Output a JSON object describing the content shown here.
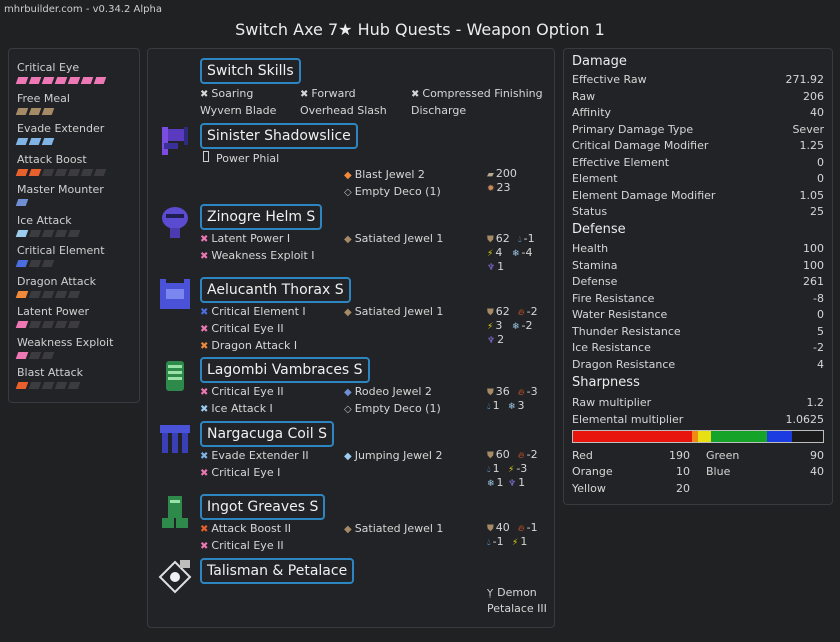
{
  "version": "mhrbuilder.com - v0.34.2 Alpha",
  "title": "Switch Axe 7★ Hub Quests - Weapon Option 1",
  "skills": [
    {
      "name": "Critical Eye",
      "color": "#ee77b5",
      "filled": 7,
      "total": 7
    },
    {
      "name": "Free Meal",
      "color": "#a58a66",
      "filled": 3,
      "total": 3
    },
    {
      "name": "Evade Extender",
      "color": "#7fb4e4",
      "filled": 3,
      "total": 3
    },
    {
      "name": "Attack Boost",
      "color": "#e8602c",
      "filled": 2,
      "total": 7
    },
    {
      "name": "Master Mounter",
      "color": "#6e8fd3",
      "filled": 1,
      "total": 1
    },
    {
      "name": "Ice Attack",
      "color": "#9dcdee",
      "filled": 1,
      "total": 5
    },
    {
      "name": "Critical Element",
      "color": "#4a6ee0",
      "filled": 1,
      "total": 3
    },
    {
      "name": "Dragon Attack",
      "color": "#f08a3a",
      "filled": 1,
      "total": 5
    },
    {
      "name": "Latent Power",
      "color": "#ee77b5",
      "filled": 1,
      "total": 5
    },
    {
      "name": "Weakness Exploit",
      "color": "#ee77b5",
      "filled": 1,
      "total": 3
    },
    {
      "name": "Blast Attack",
      "color": "#e8602c",
      "filled": 1,
      "total": 5
    }
  ],
  "gear": {
    "switch_skills": {
      "title": "Switch Skills",
      "items": [
        "Soaring",
        "Wyvern Blade",
        "Forward",
        "Overhead Slash",
        "Compressed Finishing",
        "Discharge"
      ]
    },
    "weapon": {
      "title": "Sinister Shadowslice",
      "phial": "Power Phial",
      "deco1": "Blast Jewel 2",
      "deco2": "Empty Deco (1)",
      "stat1": "200",
      "stat2": "23"
    },
    "helm": {
      "title": "Zinogre Helm S",
      "skill1": "Latent Power I",
      "skill2": "Weakness Exploit I",
      "deco1": "Satiated Jewel 1",
      "def": "62",
      "water": "-1",
      "thunder": "4",
      "ice": "-4",
      "dragon": "1"
    },
    "thorax": {
      "title": "Aelucanth Thorax S",
      "skill1": "Critical Element I",
      "skill2": "Critical Eye II",
      "skill3": "Dragon Attack I",
      "deco1": "Satiated Jewel 1",
      "def": "62",
      "fire": "-2",
      "thunder": "3",
      "ice": "-2",
      "dragon": "2"
    },
    "vambraces": {
      "title": "Lagombi Vambraces S",
      "skill1": "Critical Eye II",
      "skill2": "Ice Attack I",
      "deco1": "Rodeo Jewel 2",
      "deco2": "Empty Deco (1)",
      "def": "36",
      "fire": "-3",
      "water": "1",
      "ice": "3"
    },
    "coil": {
      "title": "Nargacuga Coil S",
      "skill1": "Evade Extender II",
      "skill2": "Critical Eye I",
      "deco1": "Jumping Jewel 2",
      "def": "60",
      "fire": "-2",
      "water": "1",
      "thunder": "-3",
      "ice": "1",
      "dragon": "1"
    },
    "greaves": {
      "title": "Ingot Greaves S",
      "skill1": "Attack Boost II",
      "skill2": "Critical Eye II",
      "deco1": "Satiated Jewel 1",
      "def": "40",
      "fire": "-1",
      "water": "-1",
      "thunder": "1"
    },
    "talisman": {
      "title": "Talisman & Petalace",
      "petalace1": "Demon",
      "petalace2": "Petalace III"
    }
  },
  "stats": {
    "damage_title": "Damage",
    "damage": [
      {
        "label": "Effective Raw",
        "value": "271.92"
      },
      {
        "label": "Raw",
        "value": "206"
      },
      {
        "label": "Affinity",
        "value": "40"
      },
      {
        "label": "Primary Damage Type",
        "value": "Sever"
      },
      {
        "label": "Critical Damage Modifier",
        "value": "1.25"
      },
      {
        "label": "Effective Element",
        "value": "0"
      },
      {
        "label": "Element",
        "value": "0"
      },
      {
        "label": "Element Damage Modifier",
        "value": "1.05"
      },
      {
        "label": "Status",
        "value": "25"
      }
    ],
    "defense_title": "Defense",
    "defense": [
      {
        "label": "Health",
        "value": "100"
      },
      {
        "label": "Stamina",
        "value": "100"
      },
      {
        "label": "Defense",
        "value": "261"
      },
      {
        "label": "Fire Resistance",
        "value": "-8"
      },
      {
        "label": "Water Resistance",
        "value": "0"
      },
      {
        "label": "Thunder Resistance",
        "value": "5"
      },
      {
        "label": "Ice Resistance",
        "value": "-2"
      },
      {
        "label": "Dragon Resistance",
        "value": "4"
      }
    ],
    "sharpness_title": "Sharpness",
    "sharpness_rows": [
      {
        "label": "Raw multiplier",
        "value": "1.2"
      },
      {
        "label": "Elemental multiplier",
        "value": "1.0625"
      }
    ],
    "sharpness_bar": [
      {
        "color": "#e8140e",
        "amount": 190
      },
      {
        "color": "#f08a14",
        "amount": 10
      },
      {
        "color": "#e9e013",
        "amount": 20
      },
      {
        "color": "#16a32a",
        "amount": 90
      },
      {
        "color": "#1a3ce0",
        "amount": 40
      }
    ],
    "sharpness_values": {
      "red_label": "Red",
      "red": "190",
      "orange_label": "Orange",
      "orange": "10",
      "yellow_label": "Yellow",
      "yellow": "20",
      "green_label": "Green",
      "green": "90",
      "blue_label": "Blue",
      "blue": "40"
    }
  }
}
